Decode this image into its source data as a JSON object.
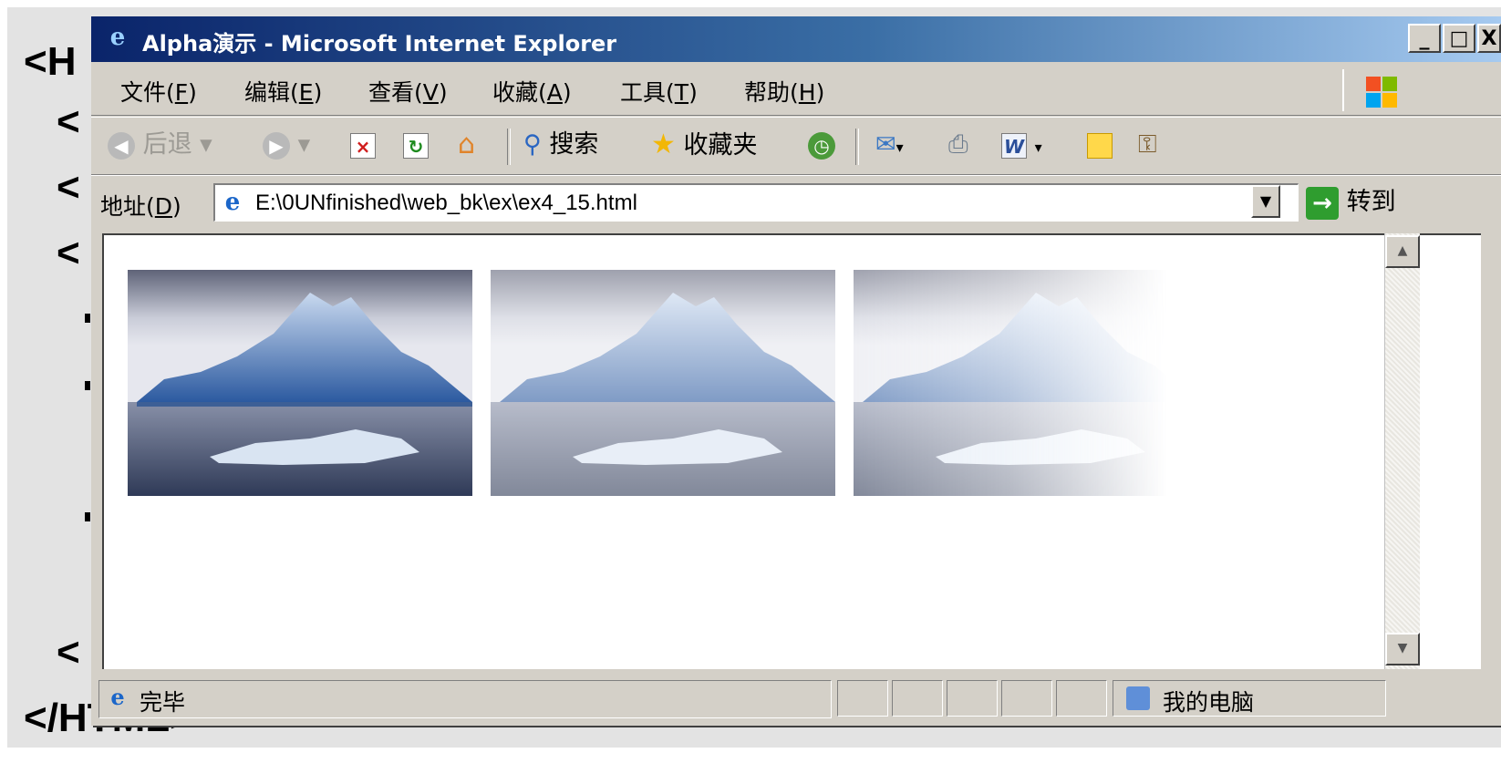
{
  "slide": {
    "code_lines": [
      "<H",
      "<",
      "<",
      "<",
      "<",
      "</HTML>"
    ]
  },
  "window": {
    "title": "Alpha演示 - Microsoft Internet Explorer",
    "buttons": {
      "minimize": "_",
      "maximize": "□",
      "close": "X"
    }
  },
  "menubar": {
    "items": [
      {
        "label": "文件",
        "key": "F"
      },
      {
        "label": "编辑",
        "key": "E"
      },
      {
        "label": "查看",
        "key": "V"
      },
      {
        "label": "收藏",
        "key": "A"
      },
      {
        "label": "工具",
        "key": "T"
      },
      {
        "label": "帮助",
        "key": "H"
      }
    ]
  },
  "toolbar": {
    "back_label": "后退",
    "search_label": "搜索",
    "favorites_label": "收藏夹"
  },
  "addressbar": {
    "label": "地址",
    "key": "D",
    "url": "E:\\0UNfinished\\web_bk\\ex\\ex4_15.html",
    "go_label": "转到"
  },
  "content": {
    "images": [
      {
        "opacity": 1.0,
        "gradient": false
      },
      {
        "opacity": 0.6,
        "gradient": false
      },
      {
        "opacity": 0.6,
        "gradient": true
      }
    ]
  },
  "statusbar": {
    "status_text": "完毕",
    "zone_text": "我的电脑"
  },
  "icons": [
    "ie-icon",
    "back-icon",
    "forward-icon",
    "stop-icon",
    "refresh-icon",
    "home-icon",
    "search-icon",
    "favorites-icon",
    "history-icon",
    "mail-icon",
    "print-icon",
    "edit-icon",
    "messenger-icon",
    "research-icon",
    "go-icon",
    "computer-icon"
  ],
  "colors": {
    "title_gradient_start": "#0a246a",
    "title_gradient_end": "#a6caf0",
    "chrome": "#d4d0c8"
  }
}
